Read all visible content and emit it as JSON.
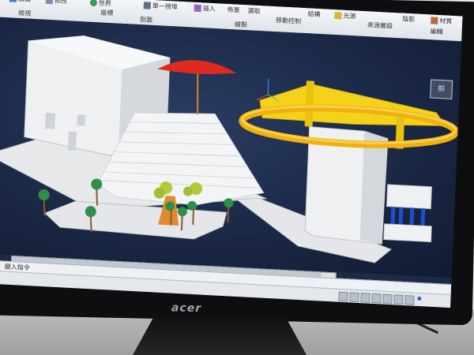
{
  "ribbon": {
    "groups": [
      {
        "label": "繪圖",
        "icon": "draw-icon"
      },
      {
        "label": "修改",
        "icon": "modify-icon"
      },
      {
        "label": "世界",
        "icon": "world-icon"
      },
      {
        "label": "座標",
        "icon": "coordinates-icon"
      },
      {
        "label": "單一視埠",
        "icon": "viewport-icon"
      },
      {
        "label": "插入",
        "icon": "insert-icon"
      },
      {
        "label": "佈景",
        "icon": "layout-icon"
      },
      {
        "label": "選取",
        "icon": "select-icon"
      },
      {
        "label": "移動控制",
        "icon": "move-control-icon"
      },
      {
        "label": "結構",
        "icon": "structure-icon"
      },
      {
        "label": "光源",
        "icon": "light-icon"
      },
      {
        "label": "來源層級",
        "icon": "source-level-icon"
      },
      {
        "label": "陰影",
        "icon": "shadow-icon"
      },
      {
        "label": "材質",
        "icon": "material-icon"
      },
      {
        "label": "編輯",
        "icon": "edit-icon"
      },
      {
        "label": "剖面",
        "icon": "section-icon"
      }
    ],
    "bottom_labels": [
      "檢視",
      "剖面",
      "繪製"
    ]
  },
  "viewport": {
    "viewcube_label": "前",
    "colors": {
      "background": "#1a2744",
      "umbrella": "#e02a1f",
      "ring": "#f0b010",
      "frame": "#f5d21a",
      "trees": "#5fa03a",
      "pillars": "#1e4fd0"
    }
  },
  "commandline": {
    "prompt": "鍵入指令"
  },
  "monitor": {
    "brand": "acer"
  }
}
